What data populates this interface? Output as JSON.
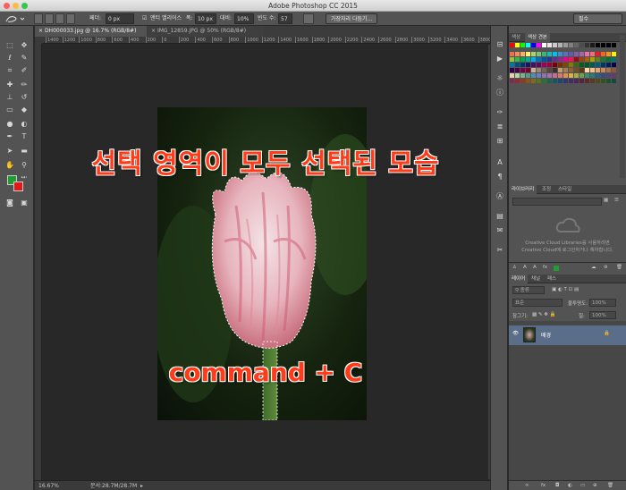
{
  "app": {
    "title": "Adobe Photoshop CC 2015"
  },
  "options_bar": {
    "feather_label": "페더:",
    "feather_value": "0 px",
    "antialias_label": "앤티 앨리어스",
    "width_label": "폭:",
    "width_value": "10 px",
    "contrast_label": "대비:",
    "contrast_value": "10%",
    "frequency_label": "빈도 수:",
    "frequency_value": "57",
    "refine_edge_button": "가장자리 다듬기...",
    "workspace_select": "필수"
  },
  "documents": {
    "tab1": "DH000033.jpg @ 16.7% (RGB/8#)",
    "tab2": "IMG_12859.JPG @ 50% (RGB/8#)"
  },
  "ruler": {
    "ticks": [
      "1400",
      "1200",
      "1000",
      "800",
      "600",
      "400",
      "200",
      "0",
      "200",
      "400",
      "600",
      "800",
      "1000",
      "1200",
      "1400",
      "1600",
      "1800",
      "2000",
      "2200",
      "2400",
      "2600",
      "2800",
      "3000",
      "3200",
      "3400",
      "3600",
      "3800"
    ]
  },
  "canvas": {
    "headline": "선택 영역이 모두 선택된 모습",
    "shortcut": "command + C",
    "text_color": "#ff3b1a"
  },
  "status_bar": {
    "zoom": "16.67%",
    "doc_size": "문서:28.7M/28.7M"
  },
  "swatches_panel": {
    "tabs": [
      "색상",
      "색상 견본"
    ]
  },
  "libraries_panel": {
    "tabs": [
      "라이브러리",
      "조정",
      "스타일"
    ],
    "message_line1": "Creative Cloud Libraries를 사용하려면",
    "message_line2": "Creative Cloud에 로그인하거나 해야합니다."
  },
  "layers_panel": {
    "tabs": [
      "레이어",
      "채널",
      "패스"
    ],
    "filter_kind": "종류",
    "blend_mode": "표준",
    "opacity_label": "불투명도:",
    "opacity_value": "100%",
    "lock_label": "잠그기:",
    "fill_label": "칠:",
    "fill_value": "100%",
    "layer_name": "배경"
  },
  "colors": {
    "foreground": "#1e9e2e",
    "background": "#e01818",
    "accent_selection": "#5a6e8a"
  }
}
